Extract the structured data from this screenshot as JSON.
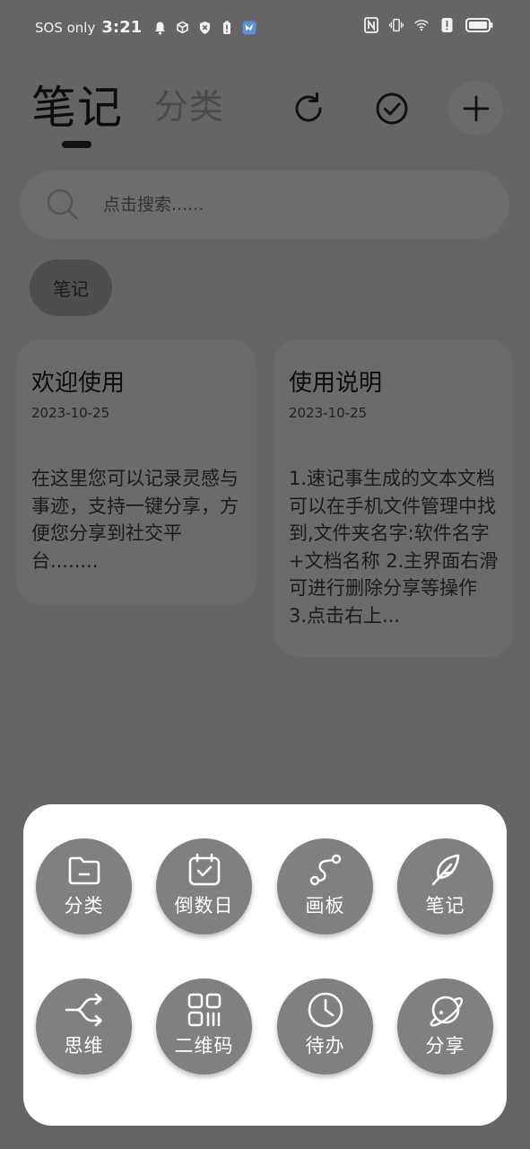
{
  "status_bar": {
    "carrier": "SOS only",
    "time": "3:21"
  },
  "header": {
    "active_tab": "笔记",
    "inactive_tab": "分类",
    "refresh_icon": "refresh-icon",
    "check_icon": "check-circle-icon",
    "add_icon": "plus-icon"
  },
  "search": {
    "placeholder": "点击搜索......"
  },
  "filter_chip": {
    "label": "笔记"
  },
  "notes": [
    {
      "title": "欢迎使用",
      "date": "2023-10-25",
      "body": "在这里您可以记录灵感与事迹，支持一键分享，方便您分享到社交平台........"
    },
    {
      "title": "使用说明",
      "date": "2023-10-25",
      "body": "1.速记事生成的文本文档可以在手机文件管理中找到,文件夹名字:软件名字+文档名称 2.主界面右滑可进行删除分享等操作 3.点击右上..."
    }
  ],
  "actions": [
    {
      "label": "分类",
      "icon": "folder-icon"
    },
    {
      "label": "倒数日",
      "icon": "calendar-check-icon"
    },
    {
      "label": "画板",
      "icon": "draw-path-icon"
    },
    {
      "label": "笔记",
      "icon": "feather-icon"
    },
    {
      "label": "思维",
      "icon": "mind-map-icon"
    },
    {
      "label": "二维码",
      "icon": "qr-code-icon"
    },
    {
      "label": "待办",
      "icon": "clock-icon"
    },
    {
      "label": "分享",
      "icon": "planet-icon"
    }
  ],
  "colors": {
    "overlay_bg": "#656565",
    "sheet_bg": "#ffffff",
    "action_button": "#808080"
  }
}
